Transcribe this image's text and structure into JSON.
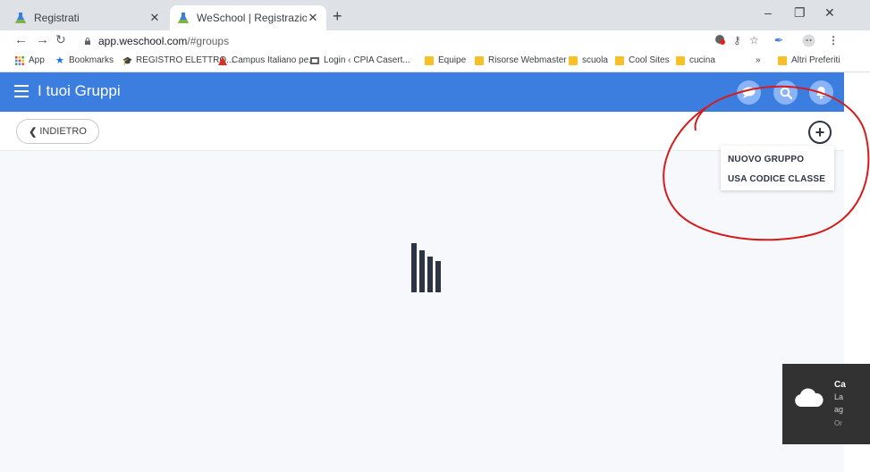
{
  "browser": {
    "tabs": [
      {
        "title": "Registrati",
        "active": false
      },
      {
        "title": "WeSchool | Registrazione",
        "active": true
      }
    ],
    "url_host": "app.weschool.com",
    "url_path": "/#groups",
    "bookmarks": [
      {
        "label": "App",
        "icon": "apps-grid-icon"
      },
      {
        "label": "Bookmarks",
        "icon": "star-icon"
      },
      {
        "label": "REGISTRO ELETTRO...",
        "icon": "cap-icon"
      },
      {
        "label": "Campus Italiano pe...",
        "icon": "campus-icon"
      },
      {
        "label": "Login ‹ CPIA Casert...",
        "icon": "cpia-icon"
      },
      {
        "label": "Equipe",
        "icon": "folder-icon"
      },
      {
        "label": "Risorse Webmaster",
        "icon": "folder-icon"
      },
      {
        "label": "scuola",
        "icon": "folder-icon"
      },
      {
        "label": "Cool Sites",
        "icon": "folder-icon"
      },
      {
        "label": "cucina",
        "icon": "folder-icon"
      }
    ],
    "bookmarks_overflow": "»",
    "other_bookmarks": "Altri Preferiti"
  },
  "app": {
    "title": "I tuoi Gruppi",
    "back_label": "INDIETRO",
    "menu": [
      {
        "label": "NUOVO GRUPPO"
      },
      {
        "label": "USA CODICE CLASSE"
      }
    ],
    "colors": {
      "header": "#3c7ee0",
      "dark": "#2d3443",
      "annotation": "#d41c1c"
    }
  },
  "toast": {
    "line1": "Ca",
    "line2": "La",
    "line3": "ag",
    "line4": "Or"
  }
}
